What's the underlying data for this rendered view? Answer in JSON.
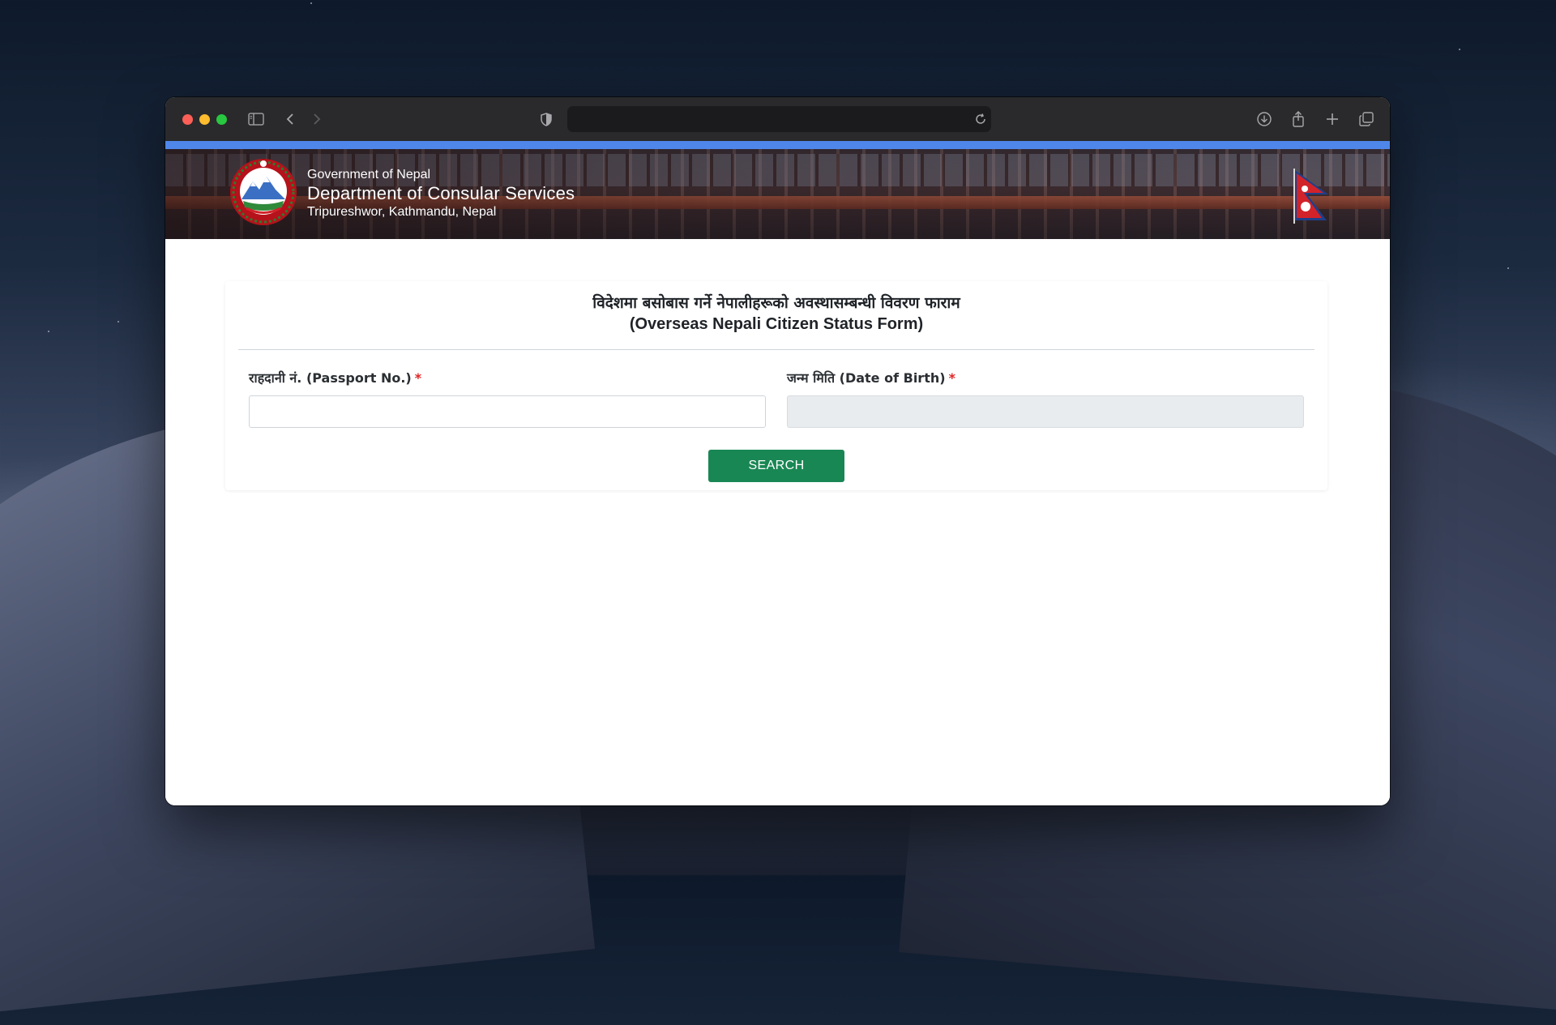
{
  "browser": {
    "url": "",
    "icons": [
      "sidebar-icon",
      "back-icon",
      "forward-icon",
      "privacy-shield-icon",
      "reload-icon",
      "download-icon",
      "share-icon",
      "new-tab-icon",
      "tab-overview-icon"
    ]
  },
  "header": {
    "line1": "Government of Nepal",
    "line2": "Department of Consular Services",
    "line3": "Tripureshwor, Kathmandu, Nepal"
  },
  "form": {
    "title_nepali": "विदेशमा बसोबास गर्ने नेपालीहरूको अवस्थासम्बन्धी विवरण फाराम",
    "title_english": "(Overseas Nepali Citizen Status Form)",
    "passport_label": "राहदानी नं. (Passport No.)",
    "passport_value": "",
    "dob_label": "जन्म मिति (Date of Birth)",
    "dob_value": "",
    "required_marker": "*",
    "search_label": "SEARCH"
  },
  "colors": {
    "accent_bar": "#4f86ea",
    "search_button": "#198754",
    "required": "#e02424"
  }
}
